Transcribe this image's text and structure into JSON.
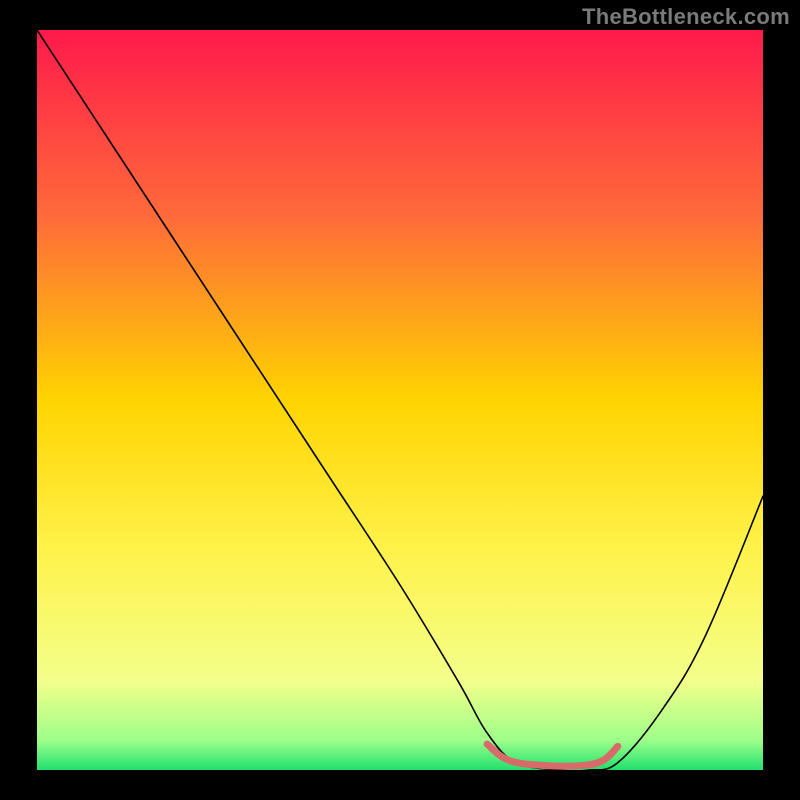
{
  "watermark": "TheBottleneck.com",
  "chart_data": {
    "type": "line",
    "title": "",
    "xlabel": "",
    "ylabel": "",
    "xlim": [
      0,
      100
    ],
    "ylim": [
      0,
      100
    ],
    "grid": false,
    "legend": false,
    "background_gradient": {
      "stops": [
        {
          "offset": 0.0,
          "color": "#ff1a4b"
        },
        {
          "offset": 0.25,
          "color": "#ff6a3a"
        },
        {
          "offset": 0.5,
          "color": "#ffd400"
        },
        {
          "offset": 0.7,
          "color": "#fff24a"
        },
        {
          "offset": 0.88,
          "color": "#f3ff8a"
        },
        {
          "offset": 0.96,
          "color": "#9dff8a"
        },
        {
          "offset": 1.0,
          "color": "#22e06e"
        }
      ]
    },
    "series": [
      {
        "name": "bottleneck-curve",
        "stroke": "#000000",
        "stroke_width": 1.6,
        "x": [
          0,
          4,
          10,
          20,
          30,
          40,
          50,
          58,
          62,
          66,
          72,
          76,
          80,
          86,
          92,
          100
        ],
        "y": [
          100,
          94,
          85,
          70,
          55,
          40,
          25,
          12,
          5,
          1,
          0,
          0,
          1,
          8,
          18,
          37
        ]
      },
      {
        "name": "optimal-range-highlight",
        "stroke": "#d96a6a",
        "stroke_width": 7,
        "x": [
          62,
          65,
          70,
          75,
          78,
          80
        ],
        "y": [
          3.5,
          1.3,
          0.6,
          0.6,
          1.3,
          3.2
        ]
      }
    ],
    "optimal_range": {
      "x_start": 62,
      "x_end": 80
    }
  }
}
